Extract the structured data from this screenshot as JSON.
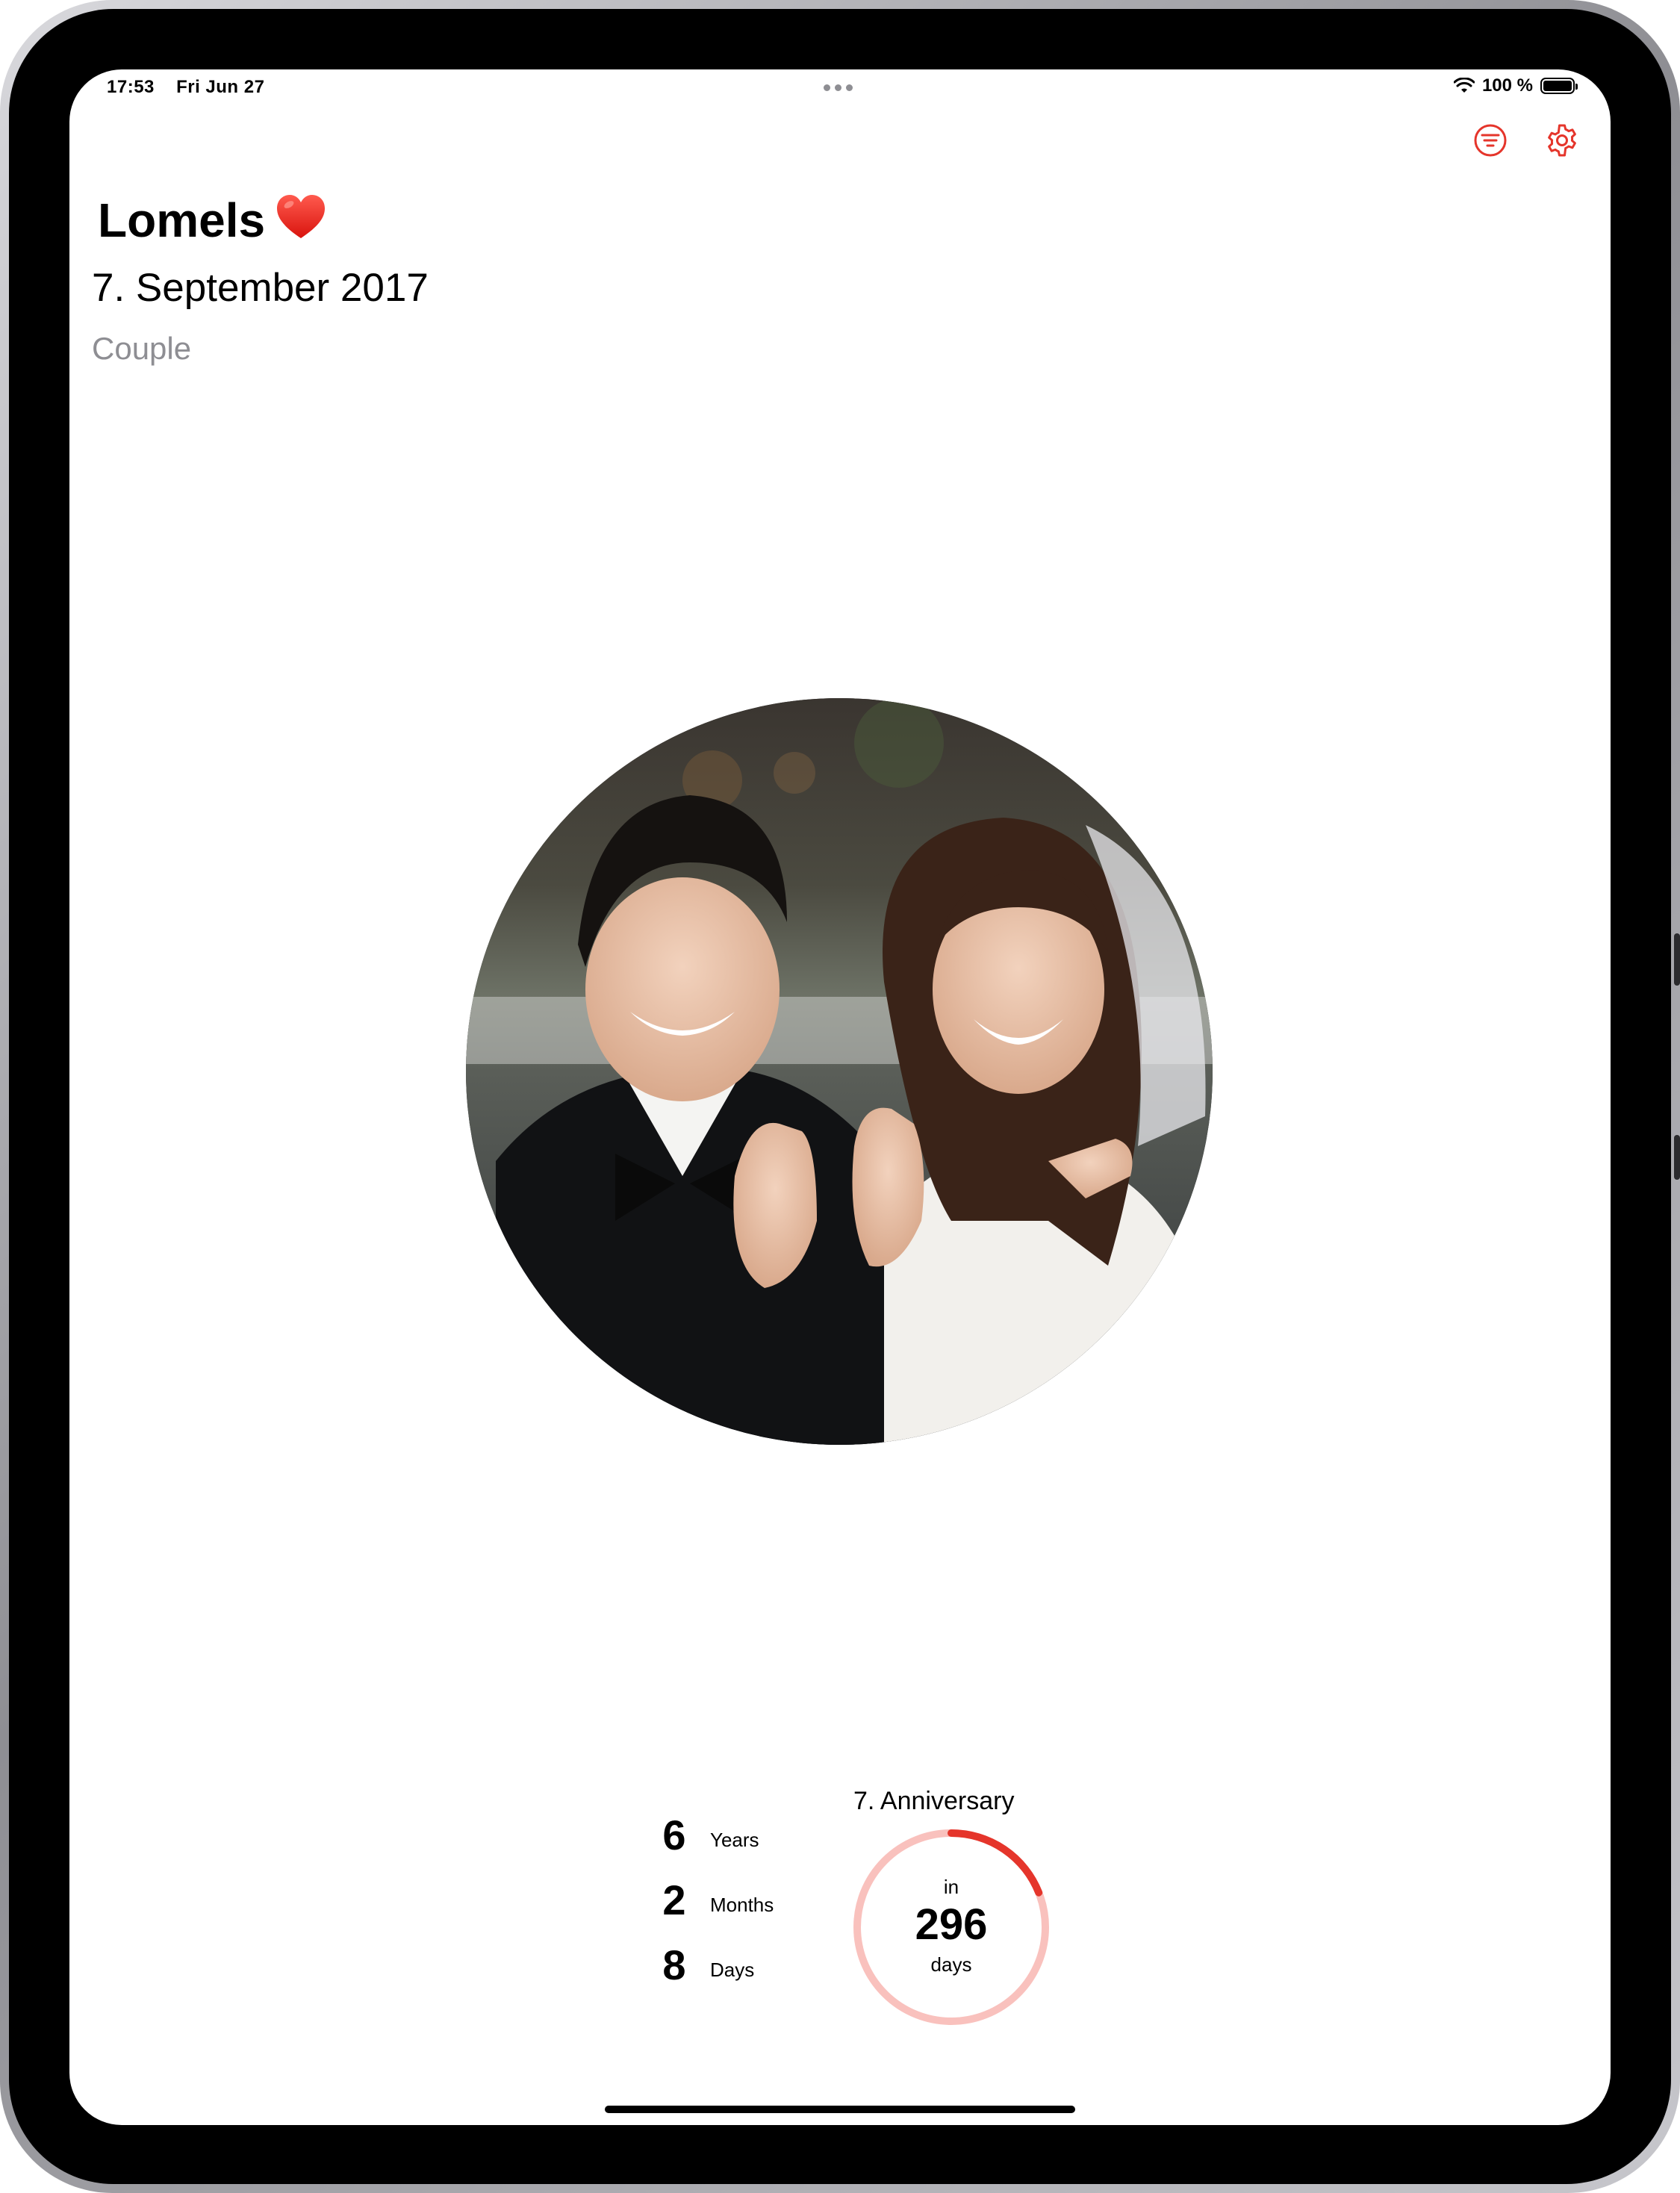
{
  "status_bar": {
    "time": "17:53",
    "date": "Fri Jun 27",
    "battery": "100 %",
    "battery_level": 1.0
  },
  "toolbar": {
    "filter_icon": "filter-lines-circle-icon",
    "settings_icon": "gear-icon",
    "accent_color": "#e5352b"
  },
  "event": {
    "title": "Lomels",
    "title_emoji_icon": "red-heart-icon",
    "date": "7. September 2017",
    "category": "Couple"
  },
  "photo": {
    "description_icon": "couple-photo"
  },
  "elapsed": {
    "years_value": "6",
    "years_label": "Years",
    "months_value": "2",
    "months_label": "Months",
    "days_value": "8",
    "days_label": "Days"
  },
  "anniversary": {
    "title": "7. Anniversary",
    "prefix": "in",
    "days_remaining": "296",
    "suffix": "days",
    "progress_fraction": 0.19,
    "ring_color": "#e5352b",
    "ring_track_color": "#f9c1bd"
  }
}
